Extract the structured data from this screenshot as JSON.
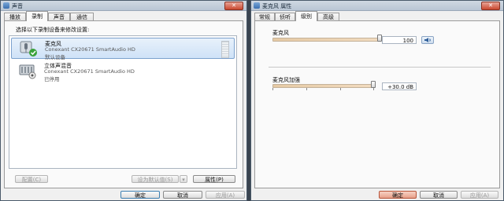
{
  "dialog1": {
    "title": "声音",
    "tabs": [
      "播放",
      "录制",
      "声音",
      "通信"
    ],
    "instruction": "选择以下录制设备来修改设置:",
    "devices": [
      {
        "name": "麦克风",
        "desc": "Conexant CX20671 SmartAudio HD",
        "state": "默认设备"
      },
      {
        "name": "立体声混音",
        "desc": "Conexant CX20671 SmartAudio HD",
        "state": "已停用"
      }
    ],
    "buttons": {
      "configure": "配置(C)",
      "set_default": "设为默认值(S)",
      "properties": "属性(P)"
    },
    "footer": {
      "ok": "确定",
      "cancel": "取消",
      "apply": "应用(A)"
    }
  },
  "dialog2": {
    "title": "麦克风 属性",
    "tabs": [
      "常规",
      "侦听",
      "级别",
      "高级"
    ],
    "mic_label": "麦克风",
    "mic_value": "100",
    "boost_label": "麦克风加强",
    "boost_value": "+30.0 dB",
    "mic_level": 1.0,
    "boost_level": 1.0,
    "footer": {
      "ok": "确定",
      "cancel": "取消",
      "apply": "应用(A)"
    }
  }
}
